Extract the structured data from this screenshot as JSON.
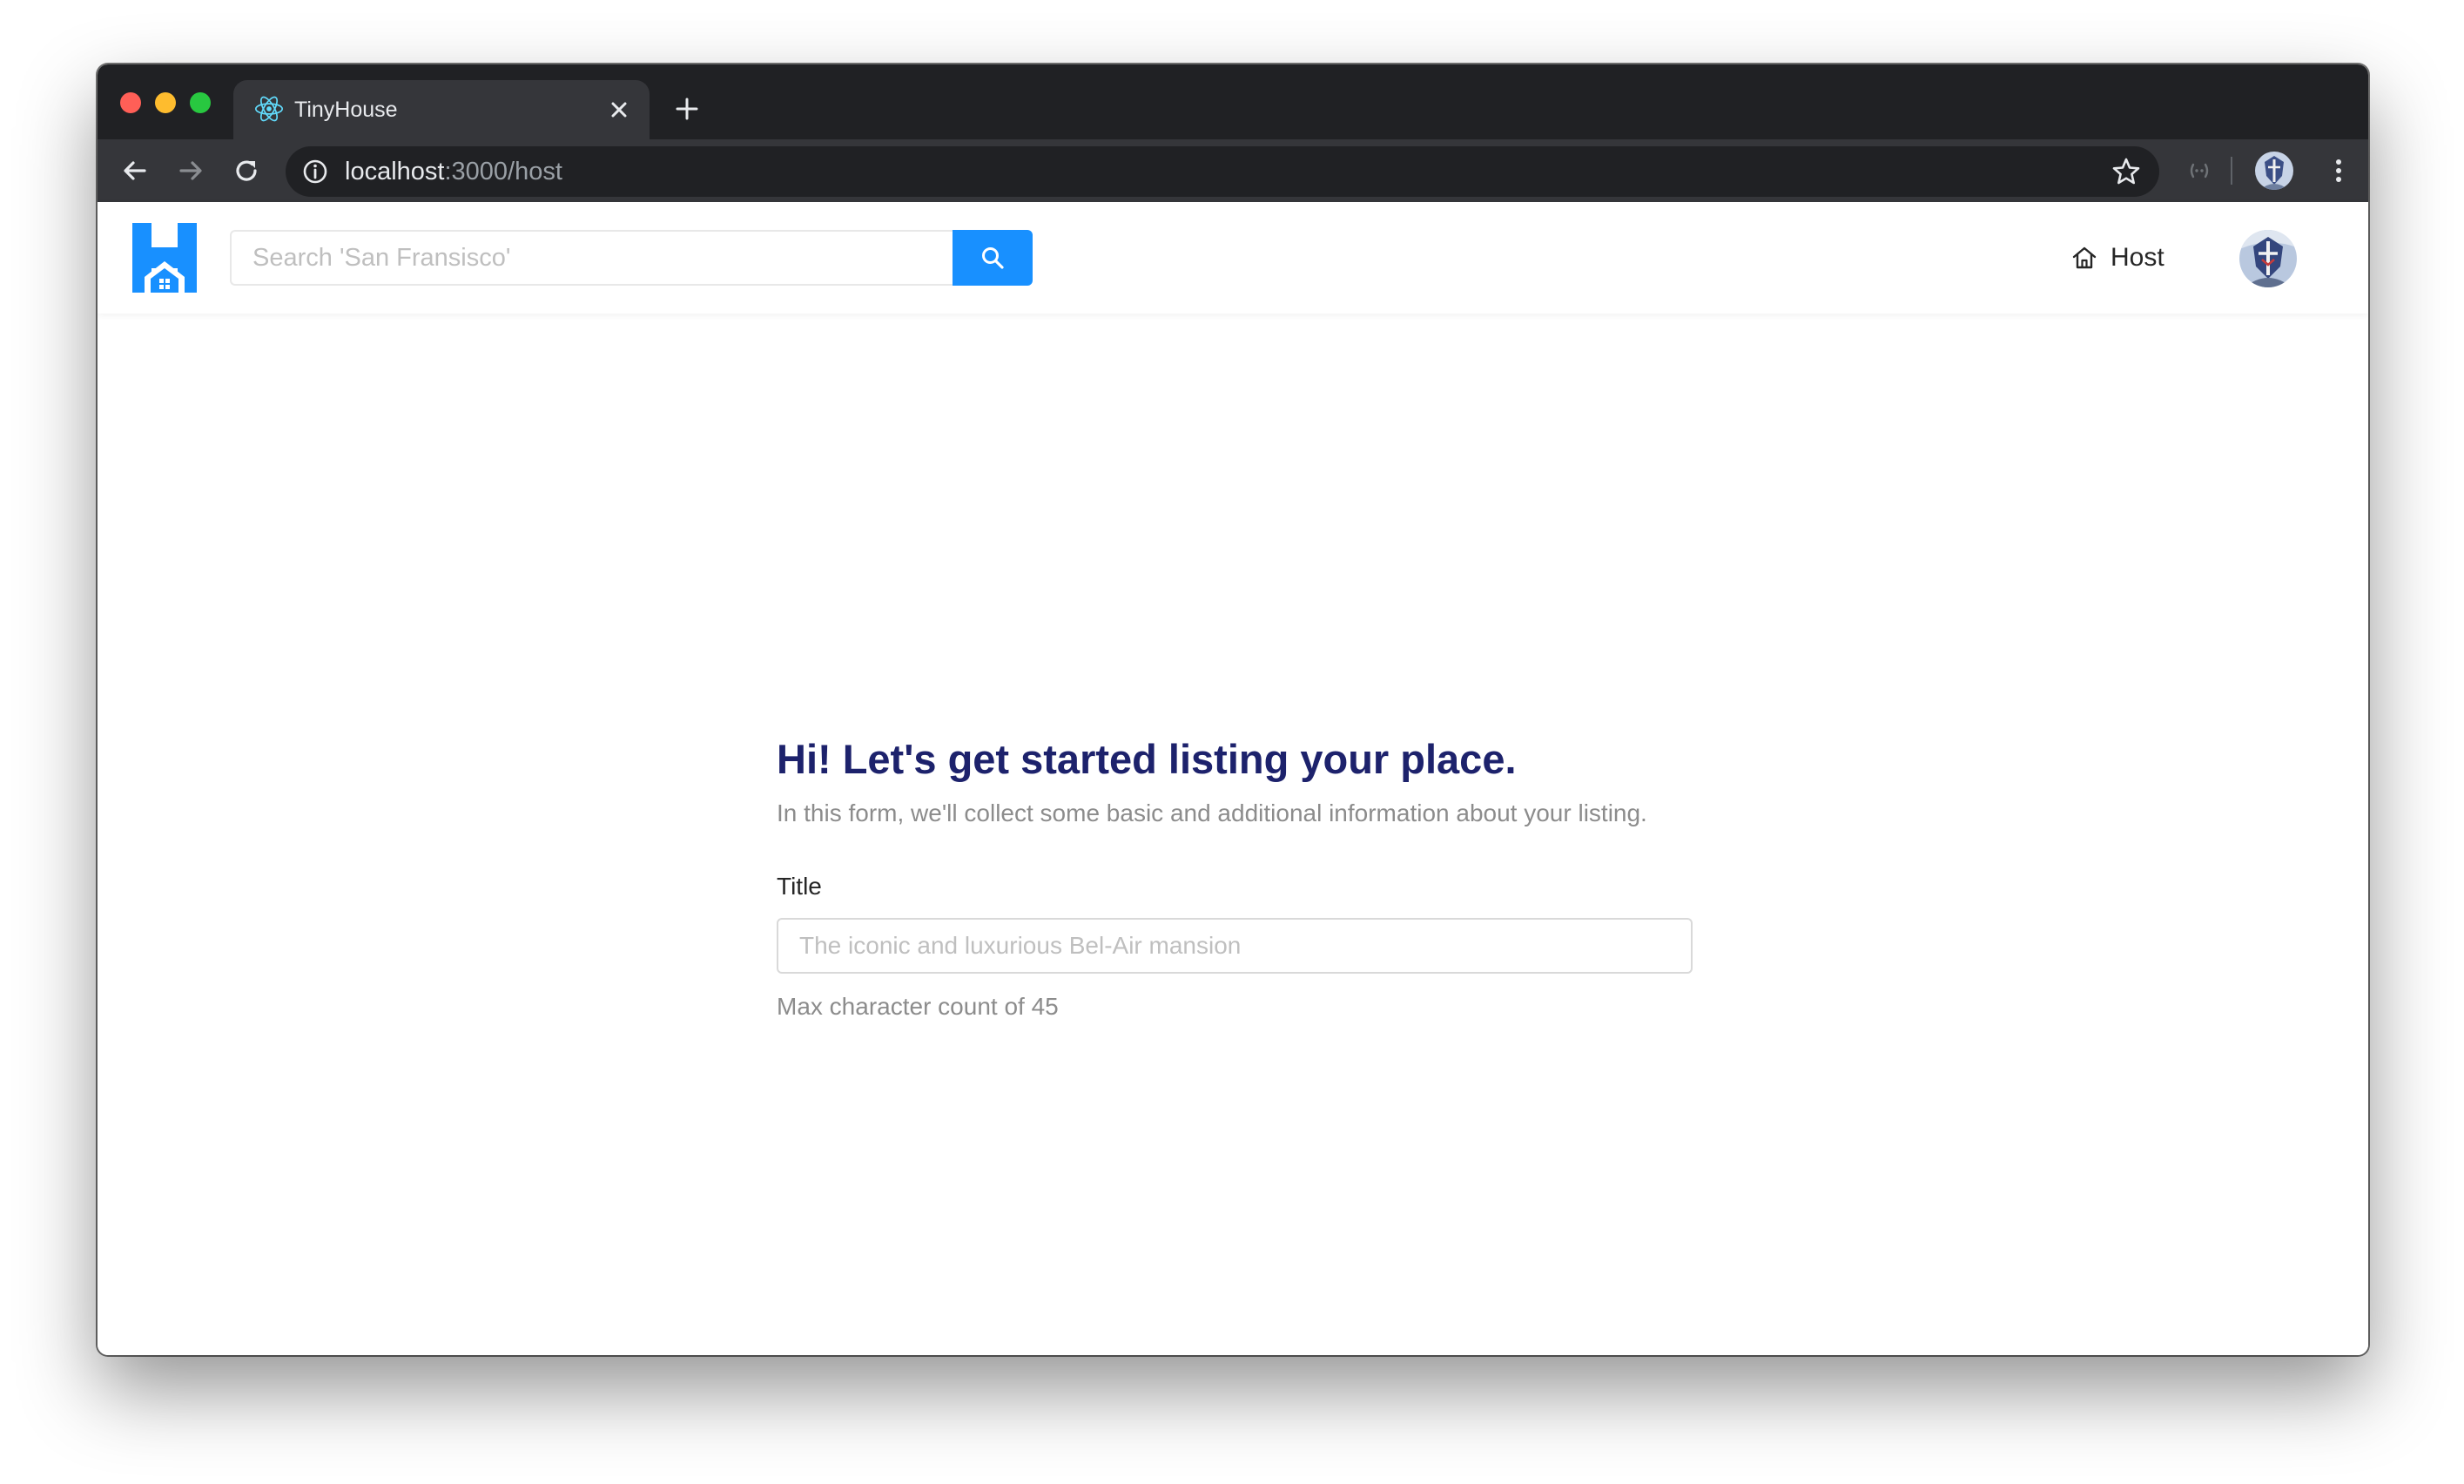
{
  "browser": {
    "tab": {
      "title": "TinyHouse",
      "favicon": "react-icon"
    },
    "address_bar": {
      "host": "localhost",
      "path": ":3000/host"
    }
  },
  "header": {
    "search": {
      "placeholder": "Search 'San Fransisco'",
      "value": ""
    },
    "nav": {
      "host_label": "Host"
    }
  },
  "form": {
    "title": "Hi! Let's get started listing your place.",
    "subtitle": "In this form, we'll collect some basic and additional information about your listing.",
    "fields": [
      {
        "label": "Title",
        "placeholder": "The iconic and luxurious Bel-Air mansion",
        "value": "",
        "help": "Max character count of 45"
      }
    ]
  },
  "colors": {
    "chrome_dark": "#202124",
    "chrome_tab": "#35363a",
    "primary": "#1890ff",
    "heading": "#1d226c",
    "muted_text": "#8c8c8c"
  }
}
